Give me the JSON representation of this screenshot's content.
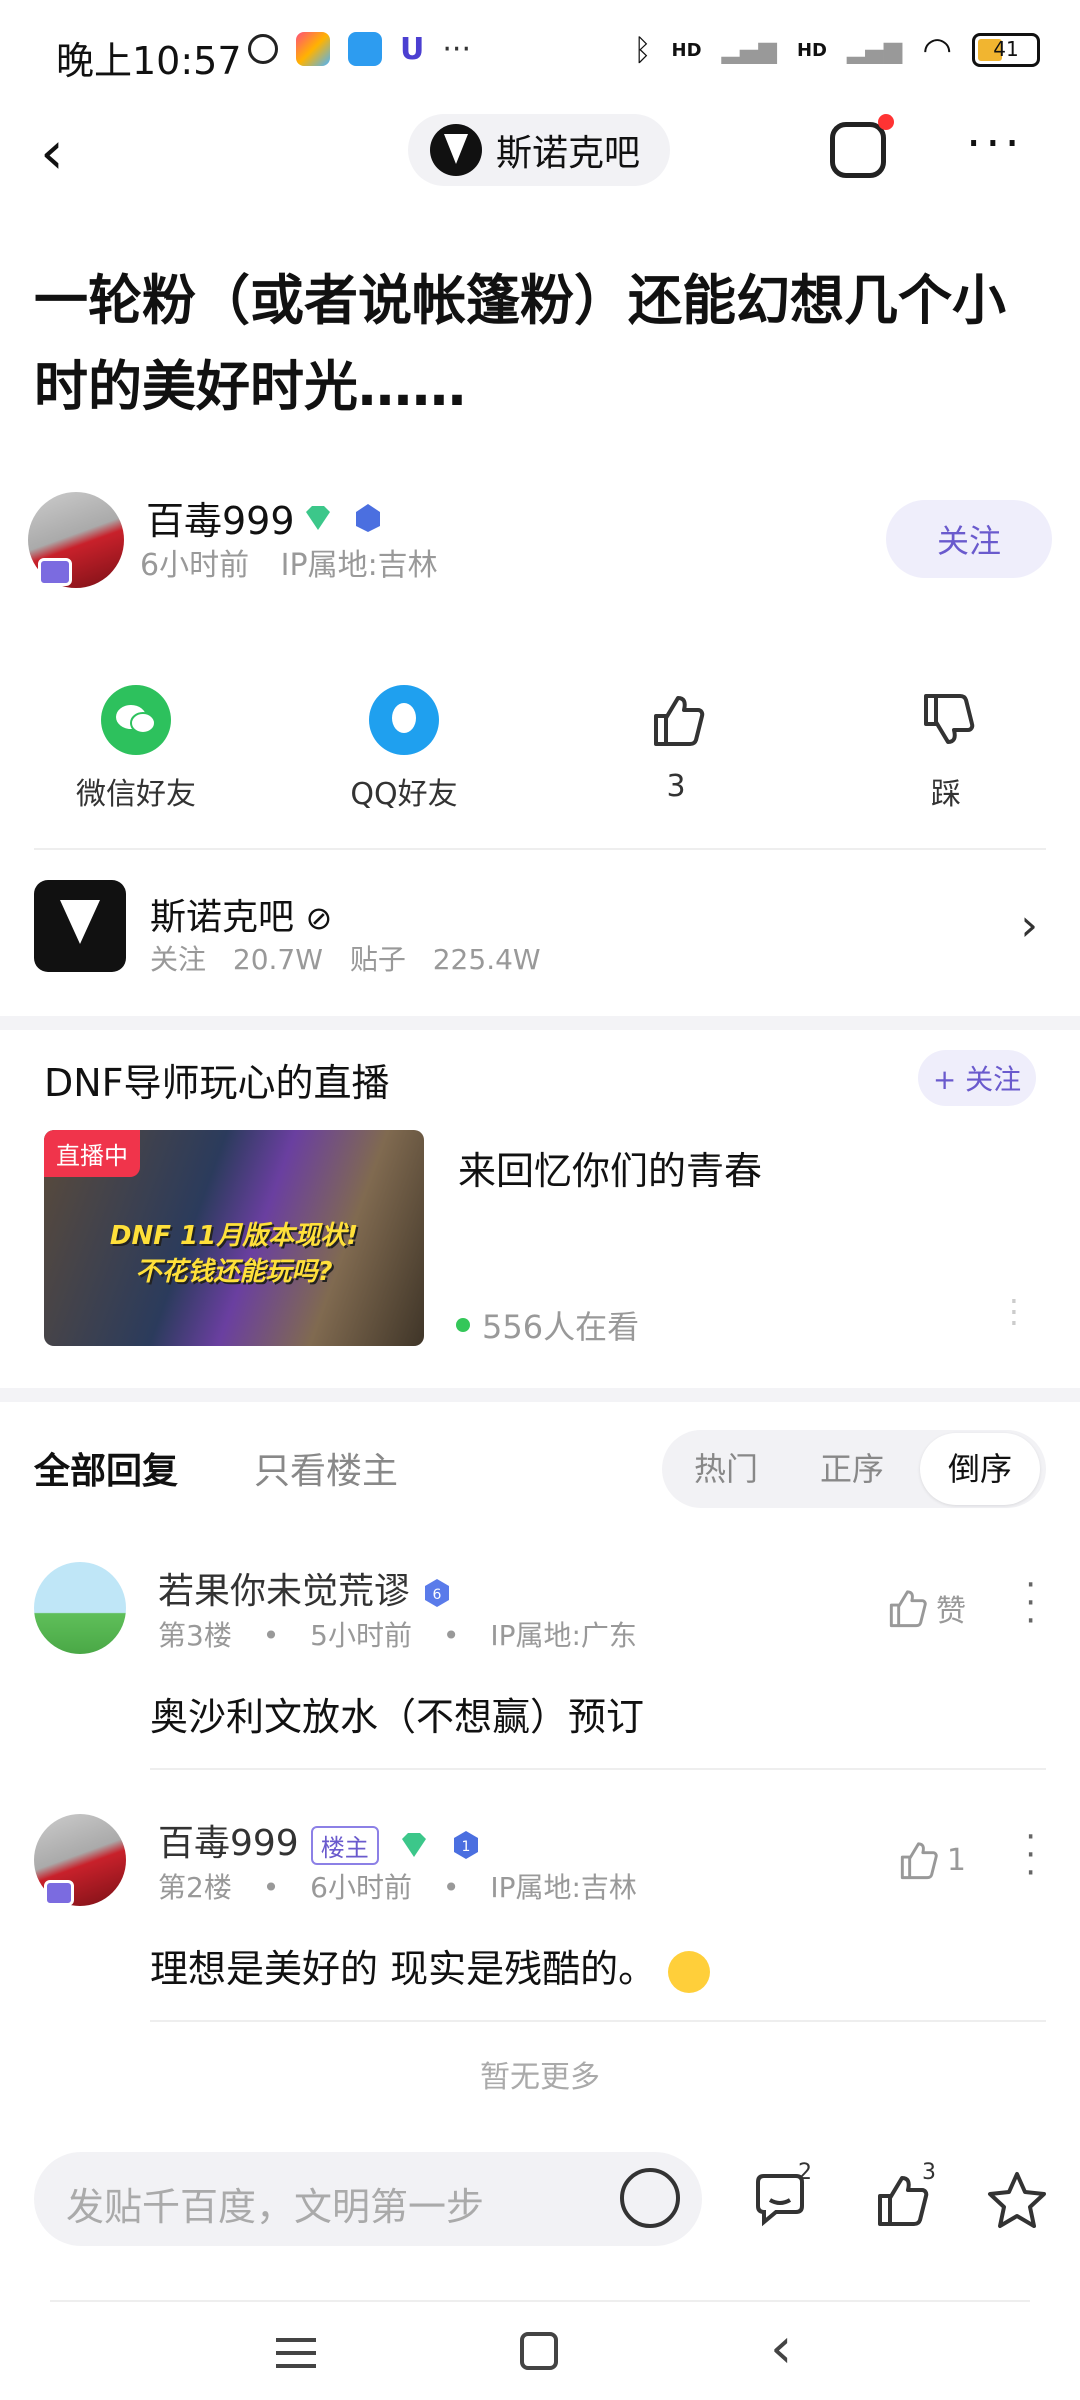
{
  "status_bar": {
    "time": "晚上10:57",
    "battery": "41",
    "signal1": "HD",
    "signal2": "HD"
  },
  "nav": {
    "forum_name": "斯诺克吧"
  },
  "post": {
    "title": "一轮粉（或者说帐篷粉）还能幻想几个小时的美好时光……"
  },
  "author": {
    "name": "百毒999",
    "time": "6小时前",
    "ip": "IP属地:吉林",
    "follow_label": "关注",
    "level": "1"
  },
  "share": {
    "wechat": "微信好友",
    "qq": "QQ好友",
    "like_count": "3",
    "dislike": "踩"
  },
  "forum": {
    "name": "斯诺克吧",
    "followers": "关注 20.7W",
    "posts": "贴子 225.4W"
  },
  "live": {
    "channel": "DNF导师玩心的直播",
    "follow": "+ 关注",
    "badge": "直播中",
    "thumb_text_1": "DNF 11月版本现状!",
    "thumb_text_2": "不花钱还能玩吗?",
    "headline": "来回忆你们的青春",
    "viewers": "556人在看"
  },
  "tabs": {
    "all": "全部回复",
    "op_only": "只看楼主",
    "sort": [
      "热门",
      "正序",
      "倒序"
    ],
    "sort_active": "倒序"
  },
  "replies": [
    {
      "name": "若果你未觉荒谬",
      "floor": "第3楼",
      "time": "5小时前",
      "ip": "IP属地:广东",
      "text": "奥沙利文放水（不想赢）预订",
      "like": "赞",
      "level": "6"
    },
    {
      "name": "百毒999",
      "tag": "楼主",
      "floor": "第2楼",
      "time": "6小时前",
      "ip": "IP属地:吉林",
      "text": "理想是美好的 现实是残酷的。",
      "like": "1",
      "level": "1"
    }
  ],
  "no_more": "暂无更多",
  "bottom_bar": {
    "placeholder": "发贴千百度，文明第一步",
    "comment_count": "2",
    "like_count": "3"
  },
  "colors": {
    "accent": "#6a5acd",
    "live_red": "#f0344b",
    "wechat": "#2dc15d",
    "qq": "#1fa0ef"
  }
}
